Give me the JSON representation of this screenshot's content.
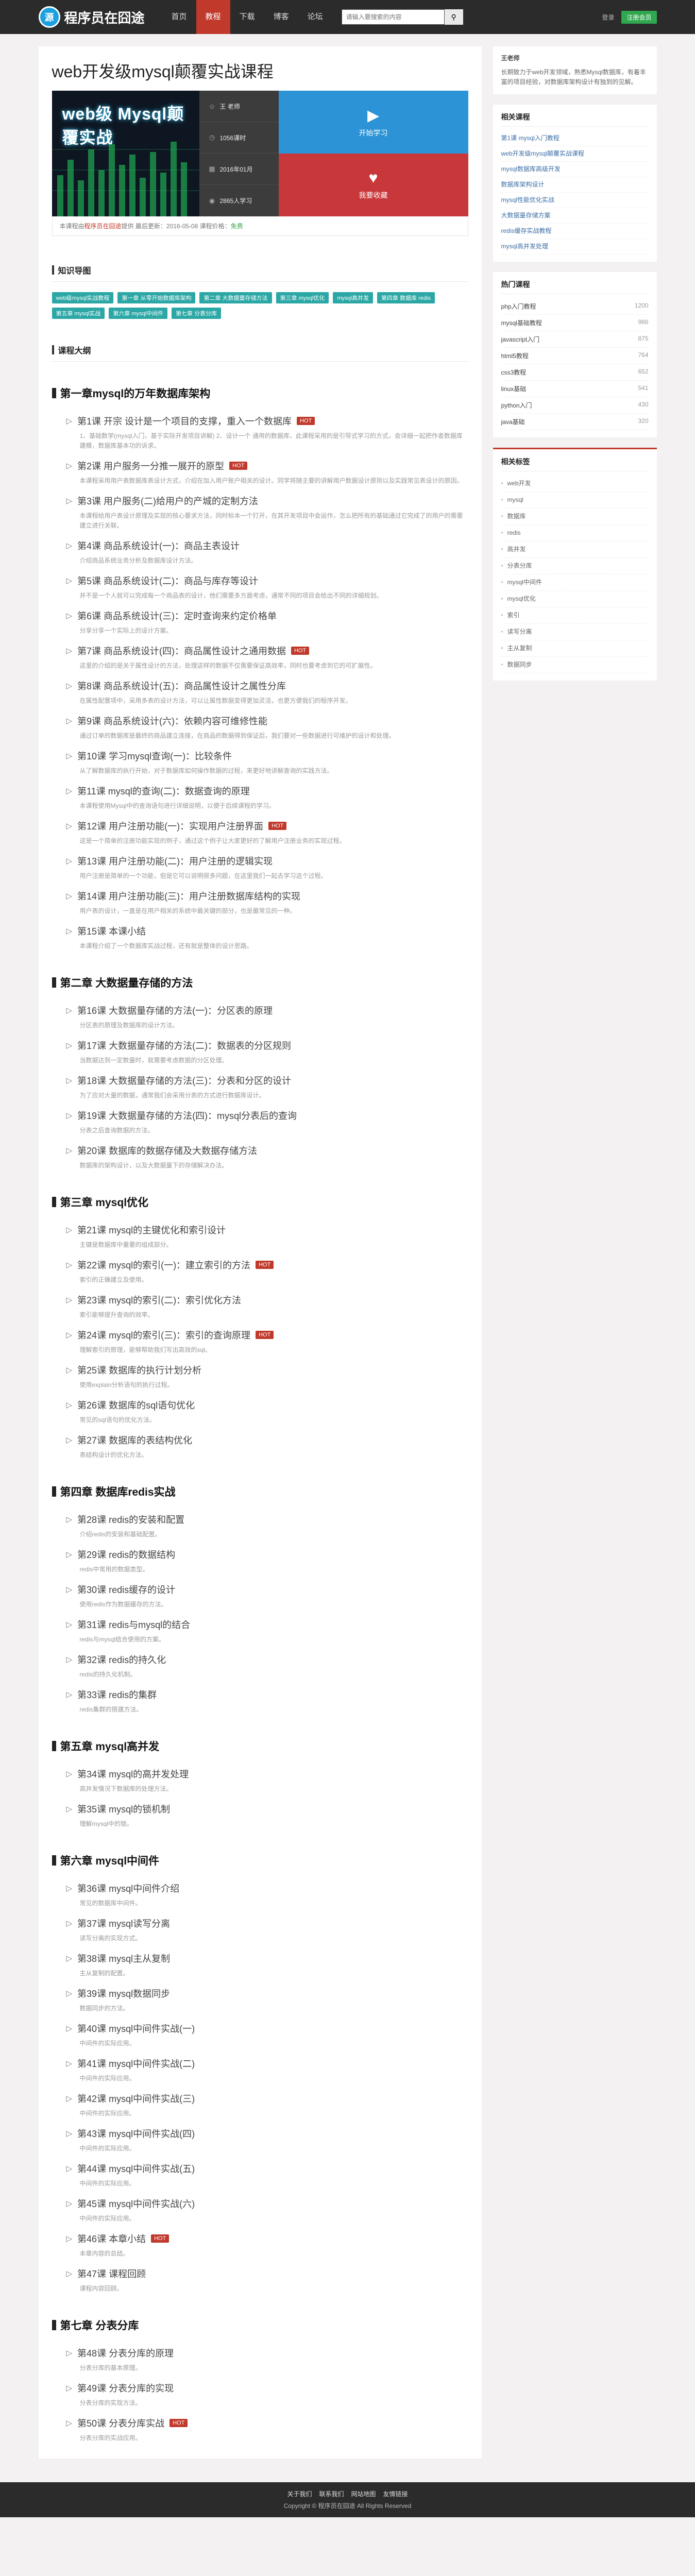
{
  "header": {
    "logo_mark": "源",
    "logo_text": "程序员在囧途",
    "nav": [
      "首页",
      "教程",
      "下载",
      "博客",
      "论坛"
    ],
    "nav_active": 1,
    "search_placeholder": "请输入要搜索的内容",
    "login": "登录",
    "register": "注册会员"
  },
  "course": {
    "title": "web开发级mysql颠覆实战课程",
    "banner_text": "web级 Mysql颠覆实战",
    "meta": [
      {
        "icon": "user-icon",
        "text": "王 老师"
      },
      {
        "icon": "clock-icon",
        "text": "1056课时"
      },
      {
        "icon": "calendar-icon",
        "text": "2016年01月"
      },
      {
        "icon": "eye-icon",
        "text": "2865人学习"
      }
    ],
    "play_label": "开始学习",
    "fav_label": "我要收藏",
    "foot_a": "本课程由",
    "foot_b": "程序员在囧途",
    "foot_c": "提供 ",
    "foot_d": "最后更新：",
    "foot_e": "2016-05-08",
    "foot_f": " 课程价格：",
    "foot_g": "免费"
  },
  "tags_head": "知识导图",
  "tags": [
    "web级mysql实战教程",
    "第一章 从零开始数据库架构",
    "第二章 大数据量存储方法",
    "第三章 mysql优化",
    "mysql高并发",
    "第四章 数据库 redis",
    "第五章 mysql实战",
    "第六章 mysql中间件",
    "第七章 分表分库"
  ],
  "outline_head": "课程大纲",
  "chapters": [
    {
      "title": "第一章mysql的万年数据库架构",
      "lessons": [
        {
          "title": "第1课 开宗 设计是一个项目的支撑，重入一个数据库",
          "hot": true,
          "desc": "1、基础数学(mysql入门，基于实际开发项目讲解) 2、设计一个 通用的数据库，此课程采用的是引导式学习的方式，会详细一起把作者数据库建模，数据库基本功的诉求。"
        },
        {
          "title": "第2课 用户服务一分推一展开的原型",
          "hot": true,
          "desc": "本课程采用用户表数据库表设计方式，介绍在加入用户账户相关的设计。同学将随主要的讲解用户数据设计原则以及实践常见表设计的原因。"
        },
        {
          "title": "第3课 用户服务(二)给用户的产城的定制方法",
          "hot": false,
          "desc": "本课程给用户表设计原理及实现的核心要求方法，同时标本一个打开，在其开发项目中会运作，怎么把所有的基础通过它完成了的用户的需要建立进行关联。"
        },
        {
          "title": "第4课 商品系统设计(一)：商品主表设计",
          "hot": false,
          "desc": "介绍商品系统业务分析及数据库设计方法。"
        },
        {
          "title": "第5课 商品系统设计(二)：商品与库存等设计",
          "hot": false,
          "desc": "并不是一个人就可以完成每一个商品表的设计，他们需要多方面考虑，通常不同的项目会给出不同的详细规划。"
        },
        {
          "title": "第6课 商品系统设计(三)：定时查询来约定价格单",
          "hot": false,
          "desc": "分享分享一个实际上的设计方案。"
        },
        {
          "title": "第7课 商品系统设计(四)：商品属性设计之通用数据",
          "hot": true,
          "desc": "这里的介绍的是关于属性设计的方法，处理这样的数据不仅需要保证高效率，同时也要考虑到它的可扩展性。"
        },
        {
          "title": "第8课 商品系统设计(五)：商品属性设计之属性分库",
          "hot": false,
          "desc": "在属性配置项中，采用多表的设计方法，可以让属性数据变得更加灵活，也更方便我们的程序开发。"
        },
        {
          "title": "第9课 商品系统设计(六)：依赖内容可维修性能",
          "hot": false,
          "desc": "通过订单的数据库是最终的商品建立连接，在商品的数据得到保证后，我们要对一些数据进行可维护的设计和处理。"
        },
        {
          "title": "第10课 学习mysql查询(一)：比较条件",
          "hot": false,
          "desc": "从了解数据库的执行开始，对于数据库如何操作数据的过程，来更好地讲解查询的实践方法。"
        },
        {
          "title": "第11课 mysql的查询(二)：数据查询的原理",
          "hot": false,
          "desc": "本课程使用Mysql中的查询语句进行详细说明，以便于后续课程的学习。"
        },
        {
          "title": "第12课 用户注册功能(一)：实现用户注册界面",
          "hot": true,
          "desc": "这是一个简单的注册功能实现的例子，通过这个例子让大家更好的了解用户注册业务的实现过程。"
        },
        {
          "title": "第13课 用户注册功能(二)：用户注册的逻辑实现",
          "hot": false,
          "desc": "用户注册是简单的一个功能，但是它可以说明很多问题，在这里我们一起去学习这个过程。"
        },
        {
          "title": "第14课 用户注册功能(三)：用户注册数据库结构的实现",
          "hot": false,
          "desc": "用户表的设计，一直是在用户相关的系统中最关键的部分，也是最常见的一种。"
        },
        {
          "title": "第15课 本课小结",
          "hot": false,
          "desc": "本课程介绍了一个数据库实战过程，还有就是整体的设计思路。"
        }
      ]
    },
    {
      "title": "第二章 大数据量存储的方法",
      "lessons": [
        {
          "title": "第16课 大数据量存储的方法(一)：分区表的原理",
          "hot": false,
          "desc": "分区表的原理及数据库的设计方法。"
        },
        {
          "title": "第17课 大数据量存储的方法(二)：数据表的分区规则",
          "hot": false,
          "desc": "当数据达到一定数量时，就需要考虑数据的分区处理。"
        },
        {
          "title": "第18课 大数据量存储的方法(三)：分表和分区的设计",
          "hot": false,
          "desc": "为了应对大量的数据，通常我们会采用分表的方式进行数据库设计。"
        },
        {
          "title": "第19课 大数据量存储的方法(四)：mysql分表后的查询",
          "hot": false,
          "desc": "分表之后查询数据的方法。"
        },
        {
          "title": "第20课 数据库的数据存储及大数据存储方法",
          "hot": false,
          "desc": "数据库的架构设计，以及大数据量下的存储解决办法。"
        }
      ]
    },
    {
      "title": "第三章 mysql优化",
      "lessons": [
        {
          "title": "第21课 mysql的主键优化和索引设计",
          "hot": false,
          "desc": "主键是数据库中重要的组成部分。"
        },
        {
          "title": "第22课 mysql的索引(一)：建立索引的方法",
          "hot": true,
          "desc": "索引的正确建立及使用。"
        },
        {
          "title": "第23课 mysql的索引(二)：索引优化方法",
          "hot": false,
          "desc": "索引能够提升查询的效率。"
        },
        {
          "title": "第24课 mysql的索引(三)：索引的查询原理",
          "hot": true,
          "desc": "理解索引的原理，能够帮助我们写出高效的sql。"
        },
        {
          "title": "第25课 数据库的执行计划分析",
          "hot": false,
          "desc": "使用explain分析语句的执行过程。"
        },
        {
          "title": "第26课 数据库的sql语句优化",
          "hot": false,
          "desc": "常见的sql语句的优化方法。"
        },
        {
          "title": "第27课 数据库的表结构优化",
          "hot": false,
          "desc": "表结构设计的优化方法。"
        }
      ]
    },
    {
      "title": "第四章 数据库redis实战",
      "lessons": [
        {
          "title": "第28课 redis的安装和配置",
          "hot": false,
          "desc": "介绍redis的安装和基础配置。"
        },
        {
          "title": "第29课 redis的数据结构",
          "hot": false,
          "desc": "redis中常用的数据类型。"
        },
        {
          "title": "第30课 redis缓存的设计",
          "hot": false,
          "desc": "使用redis作为数据缓存的方法。"
        },
        {
          "title": "第31课 redis与mysql的结合",
          "hot": false,
          "desc": "redis与mysql结合使用的方案。"
        },
        {
          "title": "第32课 redis的持久化",
          "hot": false,
          "desc": "redis的持久化机制。"
        },
        {
          "title": "第33课 redis的集群",
          "hot": false,
          "desc": "redis集群的搭建方法。"
        }
      ]
    },
    {
      "title": "第五章 mysql高并发",
      "lessons": [
        {
          "title": "第34课 mysql的高并发处理",
          "hot": false,
          "desc": "高并发情况下数据库的处理方法。"
        },
        {
          "title": "第35课 mysql的锁机制",
          "hot": false,
          "desc": "理解mysql中的锁。"
        }
      ]
    },
    {
      "title": "第六章 mysql中间件",
      "lessons": [
        {
          "title": "第36课 mysql中间件介绍",
          "hot": false,
          "desc": "常见的数据库中间件。"
        },
        {
          "title": "第37课 mysql读写分离",
          "hot": false,
          "desc": "读写分离的实现方式。"
        },
        {
          "title": "第38课 mysql主从复制",
          "hot": false,
          "desc": "主从复制的配置。"
        },
        {
          "title": "第39课 mysql数据同步",
          "hot": false,
          "desc": "数据同步的方法。"
        },
        {
          "title": "第40课 mysql中间件实战(一)",
          "hot": false,
          "desc": "中间件的实际应用。"
        },
        {
          "title": "第41课 mysql中间件实战(二)",
          "hot": false,
          "desc": "中间件的实际应用。"
        },
        {
          "title": "第42课 mysql中间件实战(三)",
          "hot": false,
          "desc": "中间件的实际应用。"
        },
        {
          "title": "第43课 mysql中间件实战(四)",
          "hot": false,
          "desc": "中间件的实际应用。"
        },
        {
          "title": "第44课 mysql中间件实战(五)",
          "hot": false,
          "desc": "中间件的实际应用。"
        },
        {
          "title": "第45课 mysql中间件实战(六)",
          "hot": false,
          "desc": "中间件的实际应用。"
        },
        {
          "title": "第46课 本章小结",
          "hot": true,
          "desc": "本章内容的总结。"
        },
        {
          "title": "第47课 课程回顾",
          "hot": false,
          "desc": "课程内容回顾。"
        }
      ]
    },
    {
      "title": "第七章 分表分库",
      "lessons": [
        {
          "title": "第48课 分表分库的原理",
          "hot": false,
          "desc": "分表分库的基本原理。"
        },
        {
          "title": "第49课 分表分库的实现",
          "hot": false,
          "desc": "分表分库的实现方法。"
        },
        {
          "title": "第50课 分表分库实战",
          "hot": true,
          "desc": "分表分库的实战应用。"
        }
      ]
    }
  ],
  "sidebar": {
    "teacher_name": "王老师",
    "teacher_bio": "长期致力于web开发领域，熟悉Mysql数据库，有着丰富的项目经验，对数据库架构设计有独到的见解。",
    "related_head": "相关课程",
    "related": [
      "第1课 mysql入门教程",
      "web开发级mysql颠覆实战课程",
      "mysql数据库高级开发",
      "数据库架构设计",
      "mysql性能优化实战",
      "大数据量存储方案",
      "redis缓存实战教程",
      "mysql高并发处理"
    ],
    "hot_head": "热门课程",
    "hot": [
      {
        "t": "php入门教程",
        "c": "1200"
      },
      {
        "t": "mysql基础教程",
        "c": "986"
      },
      {
        "t": "javascript入门",
        "c": "875"
      },
      {
        "t": "html5教程",
        "c": "764"
      },
      {
        "t": "css3教程",
        "c": "652"
      },
      {
        "t": "linux基础",
        "c": "541"
      },
      {
        "t": "python入门",
        "c": "430"
      },
      {
        "t": "java基础",
        "c": "320"
      }
    ],
    "tags_head": "相关标签",
    "tagslist": [
      "web开发",
      "mysql",
      "数据库",
      "redis",
      "高并发",
      "分表分库",
      "mysql中间件",
      "mysql优化",
      "索引",
      "读写分离",
      "主从复制",
      "数据同步"
    ]
  },
  "footer": {
    "links": [
      "关于我们",
      "联系我们",
      "网站地图",
      "友情链接"
    ],
    "copyright": "Copyright © 程序员在囧途 All Rights Reserved"
  }
}
